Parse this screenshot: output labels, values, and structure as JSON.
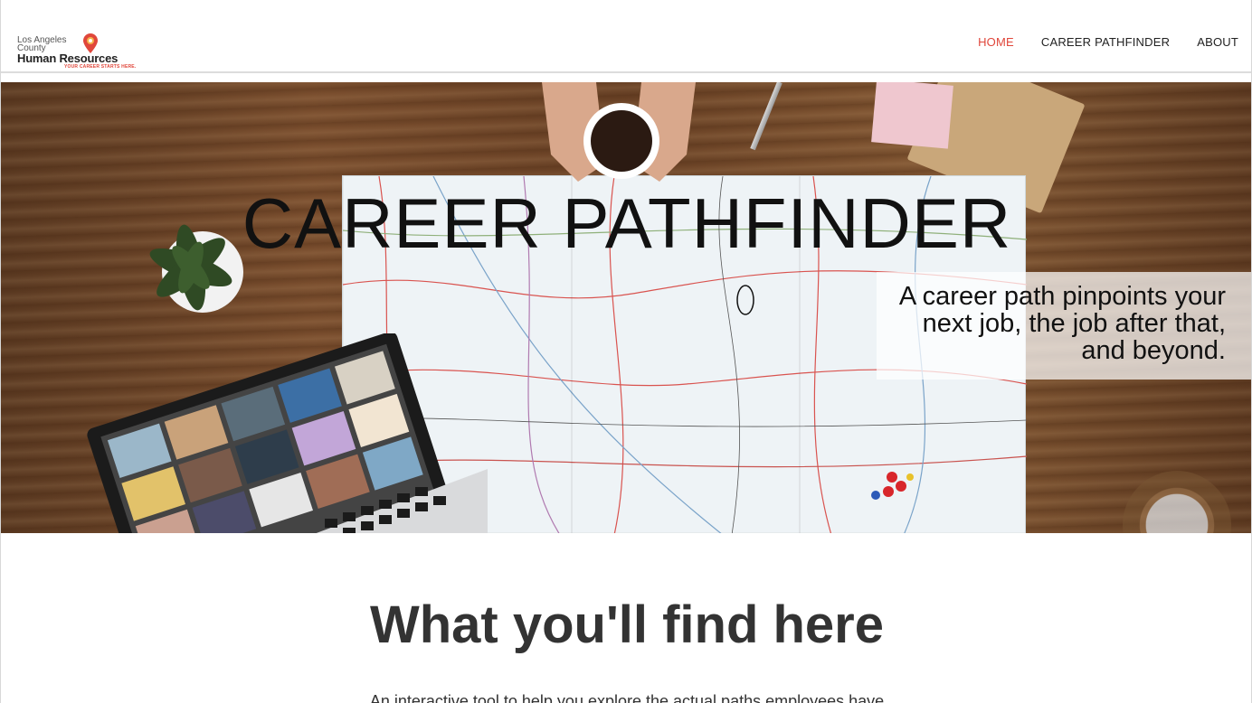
{
  "logo": {
    "line1": "Los Angeles",
    "line2": "County",
    "line3": "Human Resources",
    "tagline": "YOUR CAREER STARTS HERE."
  },
  "nav": {
    "home": "HOME",
    "career_pathfinder": "CAREER PATHFINDER",
    "about": "ABOUT"
  },
  "hero": {
    "title": "CAREER PATHFINDER",
    "tagline_line1": "A career path pinpoints your",
    "tagline_line2": "next job, the job after that,",
    "tagline_line3": "and beyond."
  },
  "section": {
    "title": "What you'll find here",
    "text": "An interactive tool to help you explore the actual paths employees have"
  },
  "colors": {
    "accent": "#e0473b",
    "text": "#333333"
  },
  "icons": [
    "location-pin-icon"
  ]
}
